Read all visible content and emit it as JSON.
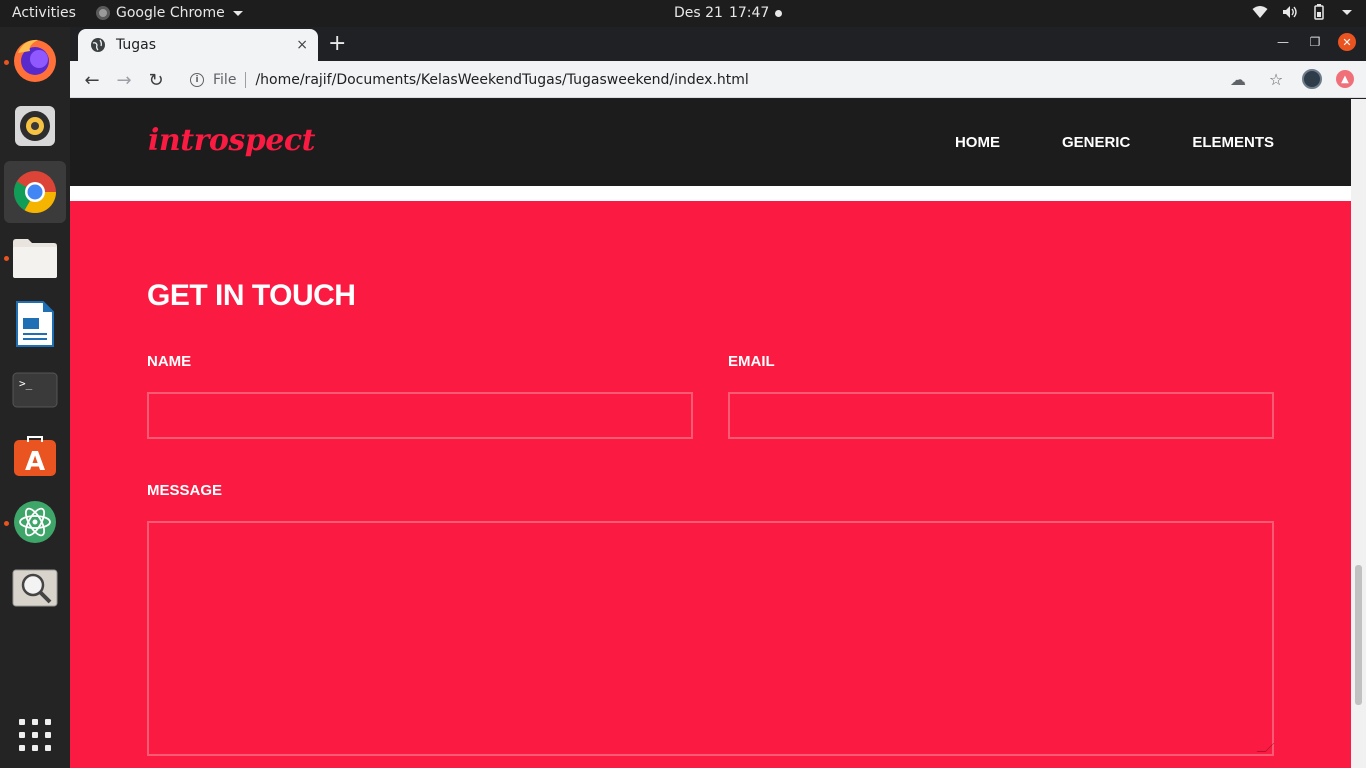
{
  "topbar": {
    "activities": "Activities",
    "app_name": "Google Chrome",
    "date": "Des 21",
    "time": "17:47"
  },
  "dock": {
    "items": [
      {
        "name": "firefox",
        "running": true
      },
      {
        "name": "rhythmbox",
        "running": false
      },
      {
        "name": "chrome",
        "running": true,
        "active": true
      },
      {
        "name": "files",
        "running": true
      },
      {
        "name": "libreoffice-writer",
        "running": false
      },
      {
        "name": "terminal",
        "running": false
      },
      {
        "name": "ubuntu-software",
        "running": false
      },
      {
        "name": "atom",
        "running": true
      },
      {
        "name": "image-viewer",
        "running": false
      }
    ]
  },
  "browser": {
    "tab_title": "Tugas",
    "tab_close": "×",
    "new_tab": "+",
    "url_scheme": "File",
    "url": "/home/rajif/Documents/KelasWeekendTugas/Tugasweekend/index.html"
  },
  "site": {
    "logo": "introspect",
    "nav": [
      "HOME",
      "GENERIC",
      "ELEMENTS"
    ],
    "colors": {
      "accent": "#fb1a41",
      "header_bg": "#1c1c1c"
    }
  },
  "contact": {
    "title": "GET IN TOUCH",
    "name_label": "NAME",
    "email_label": "EMAIL",
    "message_label": "MESSAGE",
    "name_value": "",
    "email_value": "",
    "message_value": ""
  }
}
